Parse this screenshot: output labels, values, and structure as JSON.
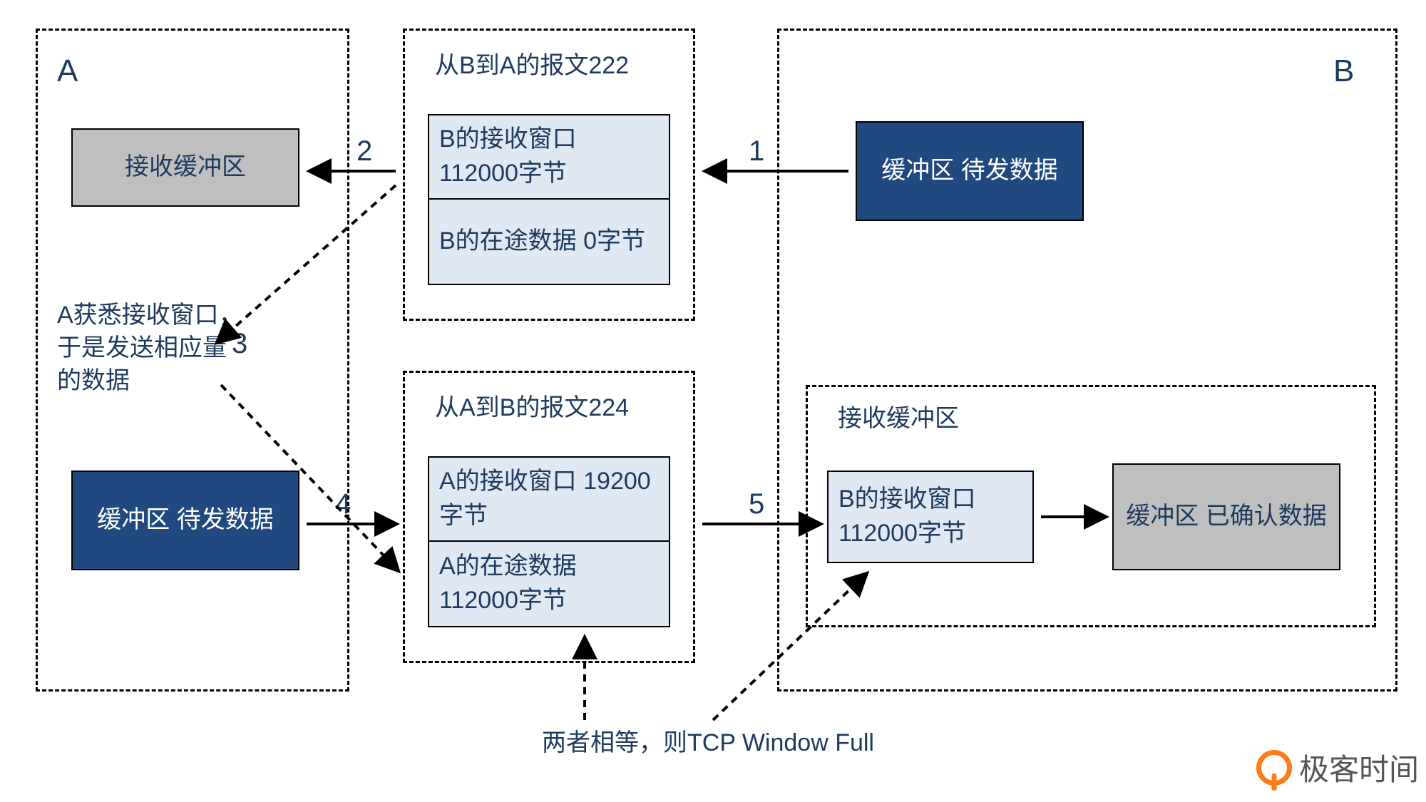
{
  "hostA": {
    "title": "A",
    "recvBuffer": "接收缓冲区",
    "note": "A获悉接收窗口，\n于是发送相应量\n的数据",
    "sendBuffer": "缓冲区\n待发数据"
  },
  "hostB": {
    "title": "B",
    "sendBuffer": "缓冲区\n待发数据",
    "recvBufferLabel": "接收缓冲区",
    "recvWindow": "B的接收窗口\n112000字节",
    "ackedBuffer": "缓冲区\n已确认数据"
  },
  "packet222": {
    "title": "从B到A的报文222",
    "win": "B的接收窗口\n112000字节",
    "inflight": "B的在途数据\n0字节"
  },
  "packet224": {
    "title": "从A到B的报文224",
    "win": "A的接收窗口\n19200字节",
    "inflight": "A的在途数据\n112000字节"
  },
  "steps": {
    "s1": "1",
    "s2": "2",
    "s3": "3",
    "s4": "4",
    "s5": "5"
  },
  "footer": "两者相等，则TCP Window Full",
  "watermark": "极客时间"
}
